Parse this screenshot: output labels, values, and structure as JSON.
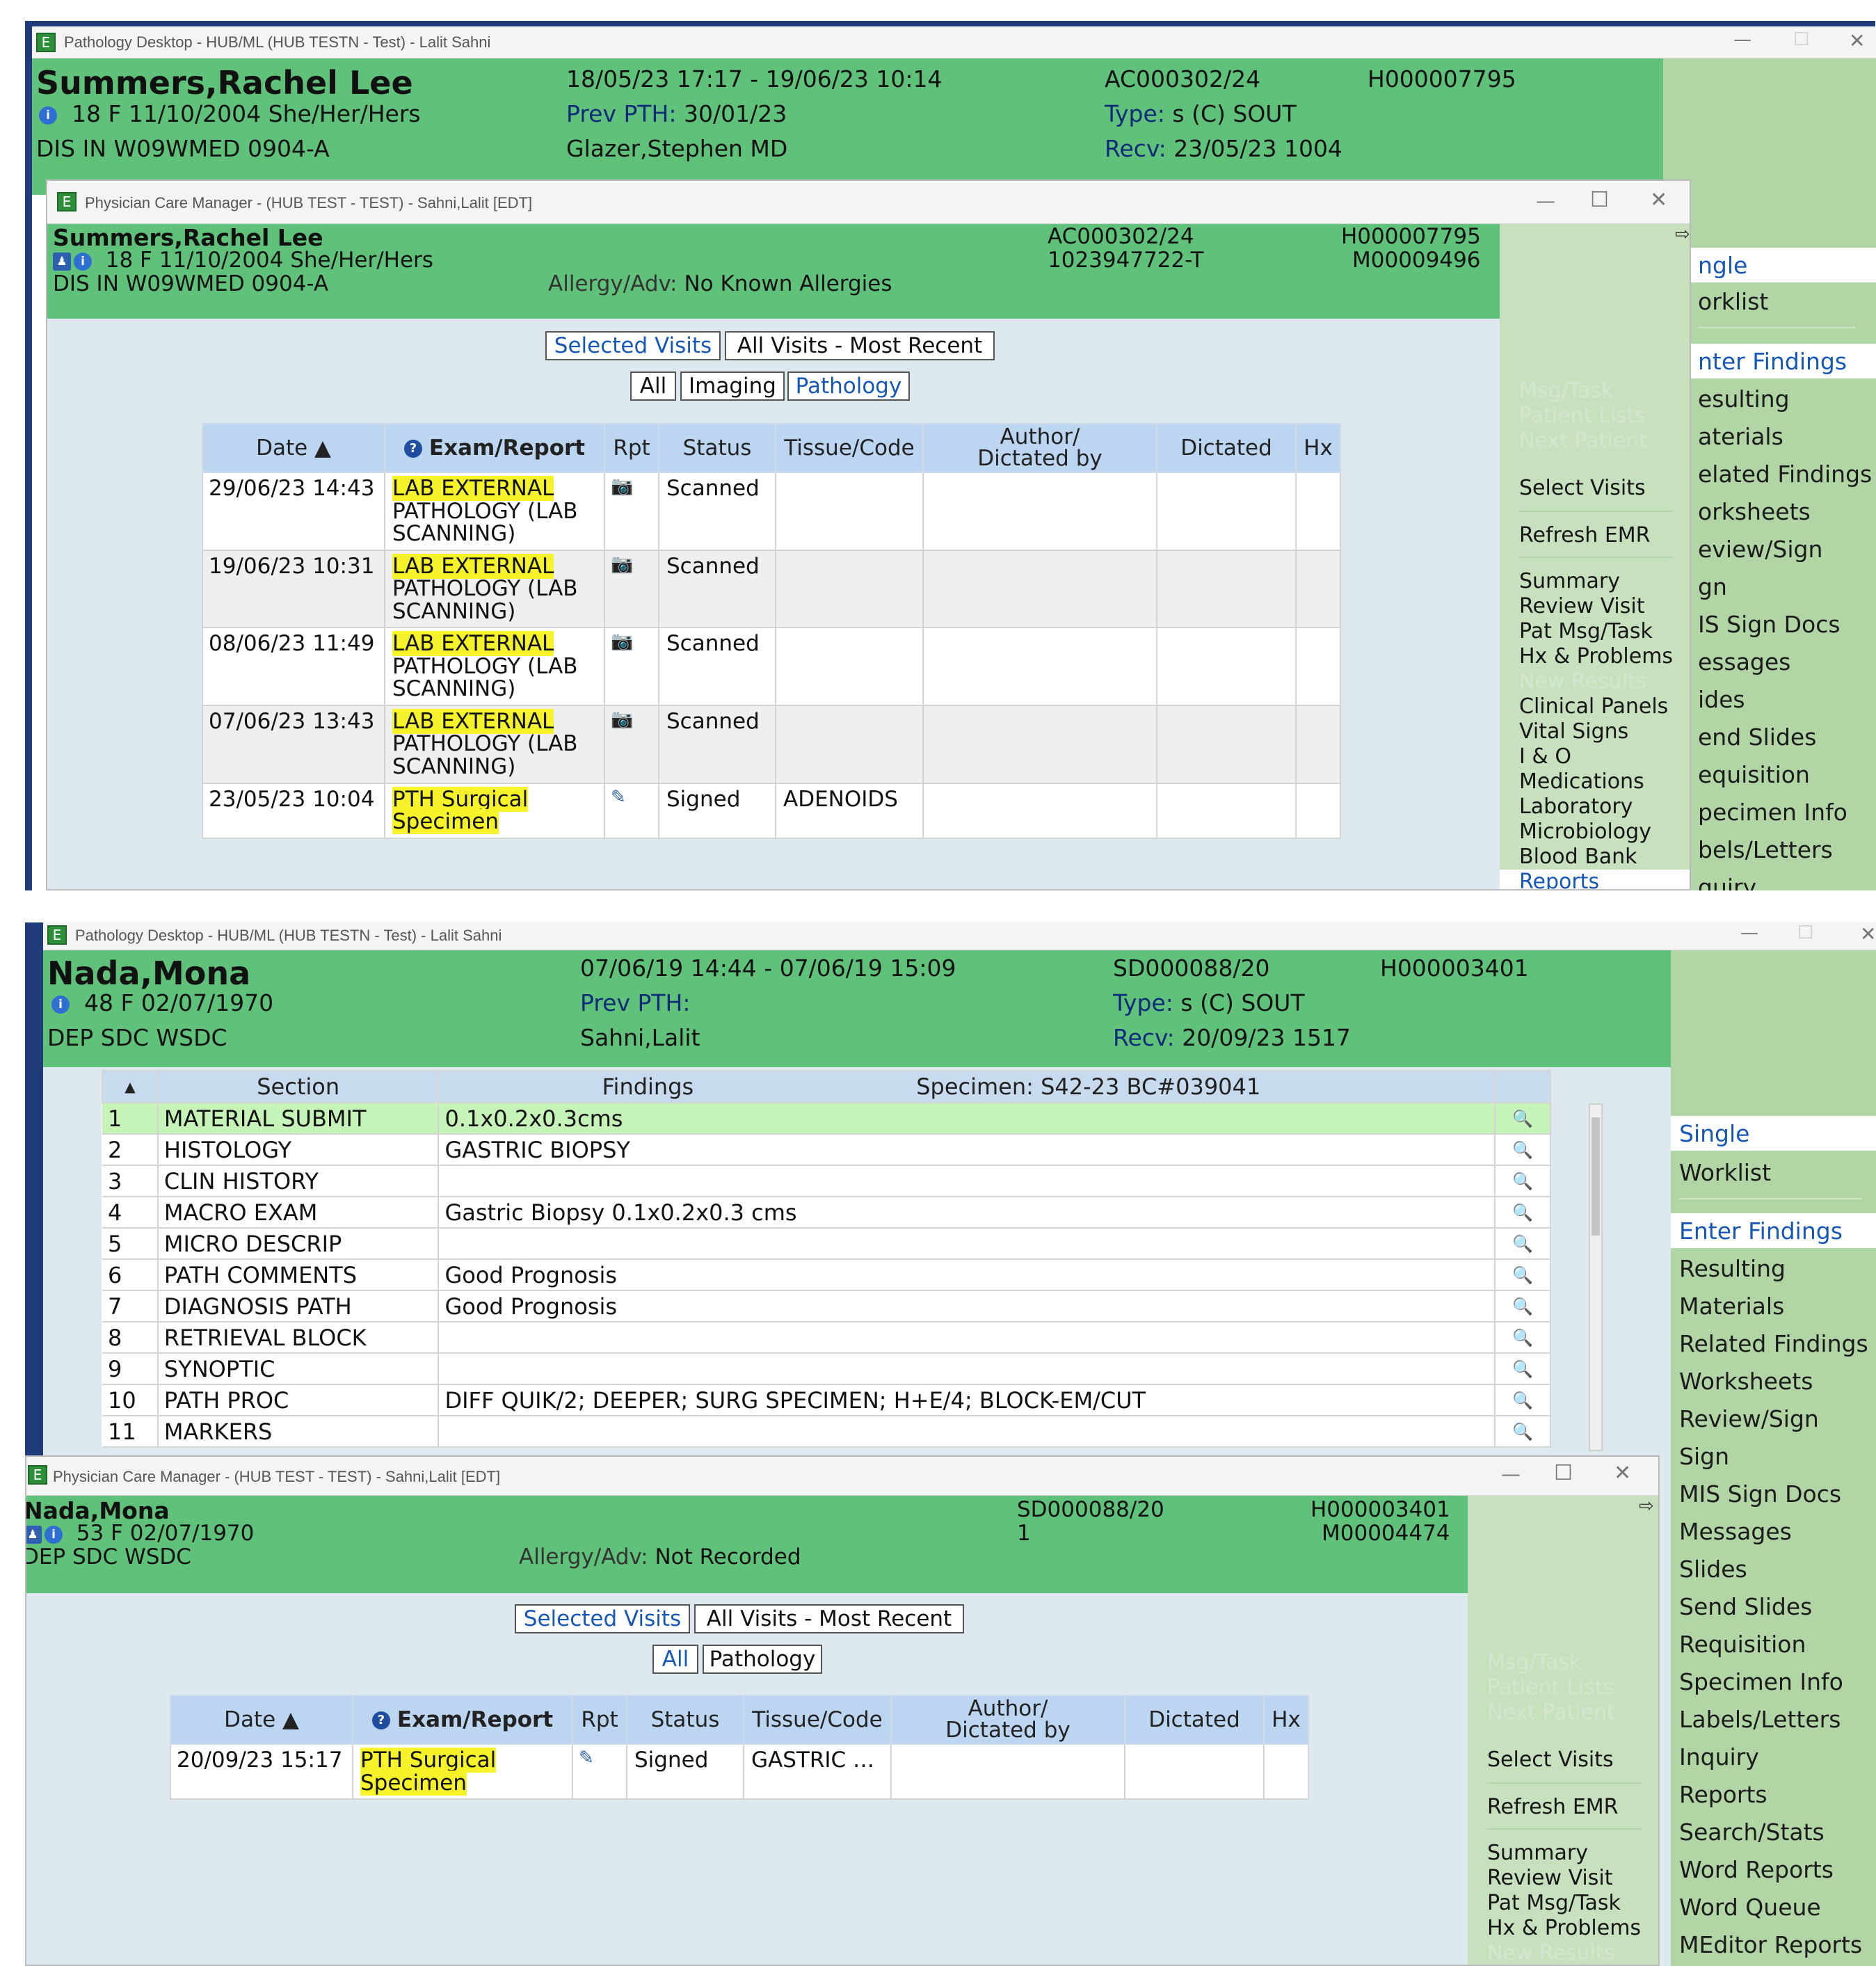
{
  "top": {
    "app_title": "Pathology Desktop - HUB/ML (HUB TESTN - Test) - Lalit Sahni",
    "patient": {
      "name": "Summers,Rachel Lee",
      "demo": "18 F 11/10/2004 She/Her/Hers",
      "location": "DIS IN  W09WMED 0904-A",
      "dates": "18/05/23 17:17 - 19/06/23 10:14",
      "prev_pth_label": "Prev PTH:",
      "prev_pth_value": "30/01/23",
      "provider": "Glazer,Stephen MD",
      "accession": "AC000302/24",
      "type_label": "Type:",
      "type_value": "s (C) SOUT",
      "recv_label": "Recv:",
      "recv_value": "23/05/23  1004",
      "mrn": "H000007795"
    },
    "right_nav": [
      "ngle",
      "orklist",
      "nter Findings",
      "esulting",
      "aterials",
      "elated Findings",
      "orksheets",
      "eview/Sign",
      "gn",
      "IS Sign Docs",
      "essages",
      "ides",
      "end Slides",
      "equisition",
      "pecimen Info",
      "bels/Letters",
      "quiry"
    ],
    "pcm": {
      "title": "Physician Care Manager - (HUB TEST - TEST) - Sahni,Lalit [EDT]",
      "name": "Summers,Rachel Lee",
      "demo": "18  F  11/10/2004  She/Her/Hers",
      "location": "DIS IN  W09WMED  0904-A",
      "allergy_label": "Allergy/Adv:",
      "allergy_value": "No Known Allergies",
      "accession": "AC000302/24",
      "account": "1023947722-T",
      "mrn": "H000007795",
      "mrn2": "M00009496",
      "visit_buttons": [
        "Selected Visits",
        "All Visits - Most Recent"
      ],
      "filter_buttons": [
        "All",
        "Imaging",
        "Pathology"
      ],
      "columns": [
        "Date ▲",
        "Exam/Report",
        "Rpt",
        "Status",
        "Tissue/Code",
        "Author/\nDictated by",
        "Dictated",
        "Hx"
      ],
      "rows": [
        {
          "date": "29/06/23 14:43",
          "exam_hl": "LAB EXTERNAL",
          "exam_rest": "PATHOLOGY (LAB SCANNING)",
          "rpt": "📷",
          "status": "Scanned",
          "tissue": ""
        },
        {
          "date": "19/06/23 10:31",
          "exam_hl": "LAB EXTERNAL",
          "exam_rest": "PATHOLOGY (LAB SCANNING)",
          "rpt": "📷",
          "status": "Scanned",
          "tissue": ""
        },
        {
          "date": "08/06/23 11:49",
          "exam_hl": "LAB EXTERNAL",
          "exam_rest": "PATHOLOGY (LAB SCANNING)",
          "rpt": "📷",
          "status": "Scanned",
          "tissue": ""
        },
        {
          "date": "07/06/23 13:43",
          "exam_hl": "LAB EXTERNAL",
          "exam_rest": "PATHOLOGY (LAB SCANNING)",
          "rpt": "📷",
          "status": "Scanned",
          "tissue": ""
        },
        {
          "date": "23/05/23 10:04",
          "exam_hl": "PTH Surgical",
          "exam_rest": "Specimen",
          "rpt": "✎",
          "status": "Signed",
          "tissue": "ADENOIDS"
        }
      ],
      "menu": {
        "disabled": [
          "Msg/Task",
          "Patient Lists",
          "Next Patient"
        ],
        "group1": [
          "Select Visits"
        ],
        "group2": [
          "Refresh EMR"
        ],
        "group3": [
          "Summary",
          "Review Visit",
          "Pat Msg/Task",
          "Hx & Problems",
          "New Results",
          "Clinical Panels",
          "Vital Signs",
          "I & O",
          "Medications",
          "Laboratory",
          "Microbiology",
          "Blood Bank",
          "Reports"
        ]
      }
    }
  },
  "bottom": {
    "app_title": "Pathology Desktop - HUB/ML (HUB TESTN - Test) - Lalit Sahni",
    "patient": {
      "name": "Nada,Mona",
      "demo": "48 F 02/07/1970",
      "location": "DEP SDC  WSDC",
      "dates": "07/06/19 14:44 - 07/06/19 15:09",
      "prev_pth_label": "Prev PTH:",
      "provider": "Sahni,Lalit",
      "accession": "SD000088/20",
      "type_label": "Type:",
      "type_value": "s (C) SOUT",
      "recv_label": "Recv:",
      "recv_value": "20/09/23  1517",
      "mrn": "H000003401"
    },
    "findings": {
      "sort_glyph": "▲",
      "section_header": "Section",
      "findings_header": "Findings",
      "specimen_label": "Specimen: S42-23  BC#039041",
      "rows": [
        {
          "n": "1",
          "section": "MATERIAL SUBMIT",
          "findings": "0.1x0.2x0.3cms"
        },
        {
          "n": "2",
          "section": "HISTOLOGY",
          "findings": "GASTRIC BIOPSY"
        },
        {
          "n": "3",
          "section": "CLIN HISTORY",
          "findings": ""
        },
        {
          "n": "4",
          "section": "MACRO EXAM",
          "findings": "Gastric Biopsy 0.1x0.2x0.3 cms"
        },
        {
          "n": "5",
          "section": "MICRO DESCRIP",
          "findings": ""
        },
        {
          "n": "6",
          "section": "PATH COMMENTS",
          "findings": "Good Prognosis"
        },
        {
          "n": "7",
          "section": "DIAGNOSIS PATH",
          "findings": "Good Prognosis"
        },
        {
          "n": "8",
          "section": "RETRIEVAL BLOCK",
          "findings": ""
        },
        {
          "n": "9",
          "section": "SYNOPTIC",
          "findings": ""
        },
        {
          "n": "10",
          "section": "PATH PROC",
          "findings": "DIFF QUIK/2; DEEPER; SURG SPECIMEN; H+E/4; BLOCK-EM/CUT"
        },
        {
          "n": "11",
          "section": "MARKERS",
          "findings": ""
        }
      ],
      "zoom_glyph": "🔍"
    },
    "right_nav": [
      "Single",
      "Worklist",
      "Enter Findings",
      "Resulting",
      "Materials",
      "Related Findings",
      "Worksheets",
      "Review/Sign",
      "Sign",
      "MIS Sign Docs",
      "Messages",
      "Slides",
      "Send Slides",
      "Requisition",
      "Specimen Info",
      "Labels/Letters",
      "Inquiry",
      "Reports",
      "Search/Stats",
      "Word Reports",
      "Word Queue",
      "MEditor Reports"
    ],
    "pcm": {
      "title": "Physician Care Manager - (HUB TEST - TEST) - Sahni,Lalit [EDT]",
      "name": "Nada,Mona",
      "demo": "53  F  02/07/1970",
      "location": "DEP SDC  WSDC",
      "allergy_label": "Allergy/Adv:",
      "allergy_value": "Not Recorded",
      "accession": "SD000088/20",
      "account": "1",
      "mrn": "H000003401",
      "mrn2": "M00004474",
      "visit_buttons": [
        "Selected Visits",
        "All Visits - Most Recent"
      ],
      "filter_buttons": [
        "All",
        "Pathology"
      ],
      "columns": [
        "Date ▲",
        "Exam/Report",
        "Rpt",
        "Status",
        "Tissue/Code",
        "Author/\nDictated by",
        "Dictated",
        "Hx"
      ],
      "rows": [
        {
          "date": "20/09/23 15:17",
          "exam_hl": "PTH Surgical",
          "exam_rest": "Specimen",
          "rpt": "✎",
          "status": "Signed",
          "tissue": "GASTRIC …"
        }
      ],
      "menu": {
        "disabled": [
          "Msg/Task",
          "Patient Lists",
          "Next Patient"
        ],
        "group1": [
          "Select Visits"
        ],
        "group2": [
          "Refresh EMR"
        ],
        "group3": [
          "Summary",
          "Review Visit",
          "Pat Msg/Task",
          "Hx & Problems",
          "New Results"
        ]
      }
    }
  },
  "window_controls": {
    "minimize": "—",
    "maximize": "☐",
    "close": "✕"
  },
  "colors": {
    "header_green": "#60c27a",
    "nav_green": "#b1d5a4",
    "highlight": "#f6f32a",
    "link_blue": "#1657b6"
  }
}
